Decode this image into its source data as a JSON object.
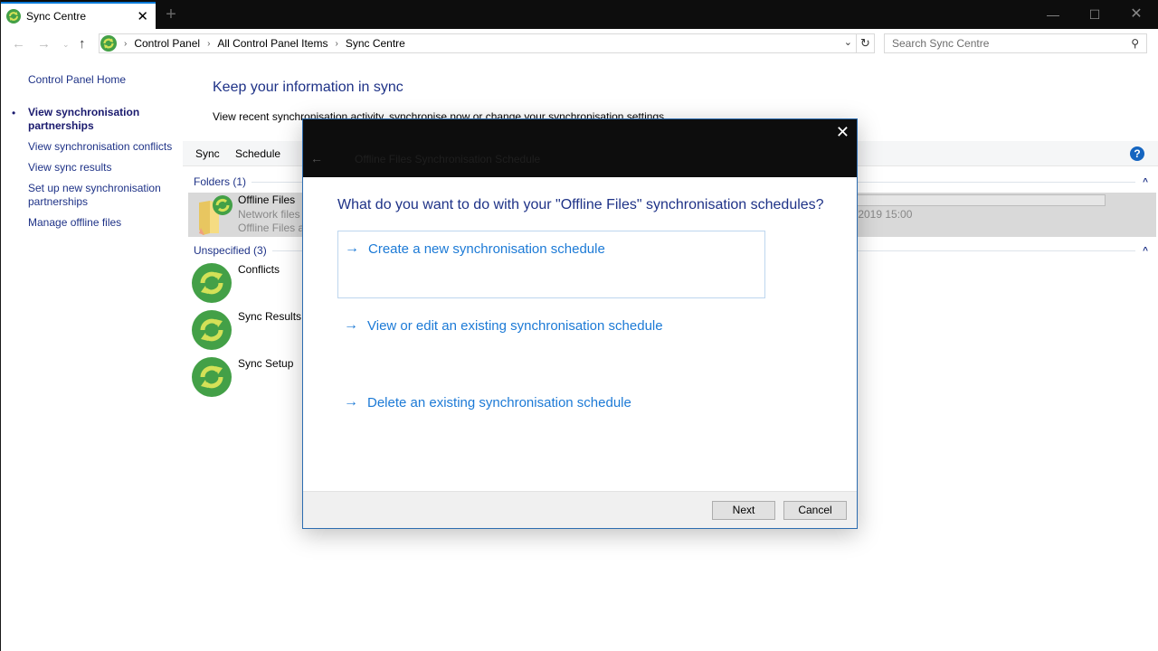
{
  "window": {
    "tab_title": "Sync Centre",
    "new_tab": "+",
    "controls": {
      "minimize": "—",
      "maximize": "☐",
      "close": "✕"
    }
  },
  "navbar": {
    "back": "←",
    "forward": "→",
    "recent": "⌄",
    "up": "↑",
    "breadcrumb": [
      "Control Panel",
      "All Control Panel Items",
      "Sync Centre"
    ],
    "crumb_separator": "›",
    "dropdown": "⌄",
    "refresh": "↻",
    "search_placeholder": "Search Sync Centre",
    "search_value": "",
    "search_icon": "⚲"
  },
  "sidebar": {
    "home": "Control Panel Home",
    "bullet": "•",
    "items": [
      {
        "label": "View synchronisation partnerships",
        "active": true
      },
      {
        "label": "View synchronisation conflicts"
      },
      {
        "label": "View sync results"
      },
      {
        "label": "Set up new synchronisation partnerships"
      },
      {
        "label": "Manage offline files"
      }
    ]
  },
  "main": {
    "title": "Keep your information in sync",
    "description": "View recent synchronisation activity, synchronise now or change your synchronisation settings.",
    "toolbar": {
      "sync": "Sync",
      "schedule": "Schedule",
      "help": "?"
    },
    "groups": [
      {
        "header": "Folders (1)",
        "collapse": "^",
        "items": [
          {
            "name": "Offline Files",
            "line1": "Network files",
            "line2": "Offline Files a",
            "date": "/2019 15:00",
            "selected": true
          }
        ]
      },
      {
        "header": "Unspecified (3)",
        "collapse": "^",
        "items": [
          {
            "name": "Conflicts"
          },
          {
            "name": "Sync Results"
          },
          {
            "name": "Sync Setup"
          }
        ]
      }
    ]
  },
  "dialog": {
    "title": "Offline Files Synchronisation Schedule",
    "back": "←",
    "close": "✕",
    "question": "What do you want to do with your \"Offline Files\" synchronisation schedules?",
    "arrow": "→",
    "options": [
      {
        "label": "Create a new synchronisation schedule",
        "focused": true
      },
      {
        "label": "View or edit an existing synchronisation schedule"
      },
      {
        "label": "Delete an existing synchronisation schedule"
      }
    ],
    "buttons": {
      "next": "Next",
      "cancel": "Cancel"
    }
  },
  "colors": {
    "link_blue": "#1e3287",
    "option_blue": "#1c7ad6",
    "titlebar": "#0d0d0d",
    "sync_green": "#4caf50",
    "sync_arrows": "#d4e157"
  }
}
